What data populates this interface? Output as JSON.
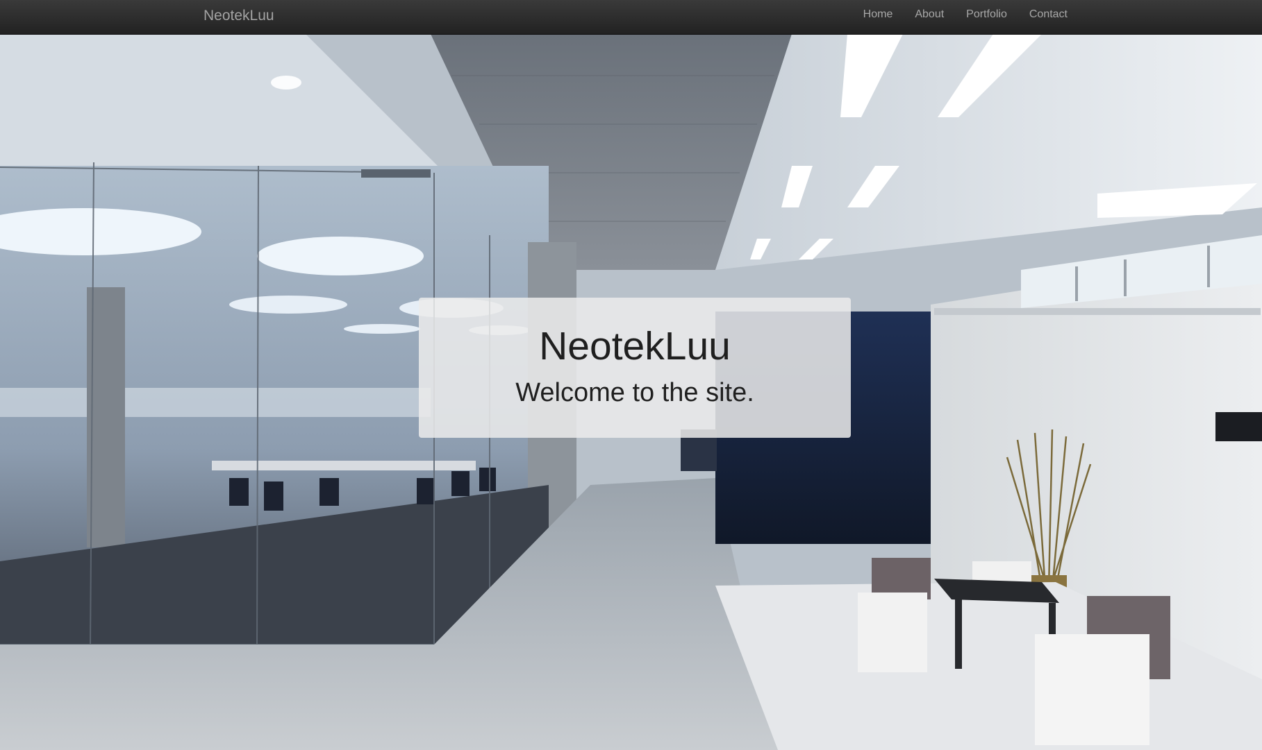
{
  "navbar": {
    "brand": "NeotekLuu",
    "links": [
      "Home",
      "About",
      "Portfolio",
      "Contact"
    ]
  },
  "hero": {
    "title": "NeotekLuu",
    "subtitle": "Welcome to the site."
  },
  "colors": {
    "navbar": "#2b2b2b",
    "nav_text": "#a8a8a8",
    "panel_bg": "#ebebeb",
    "panel_text": "#1f1f1f"
  }
}
